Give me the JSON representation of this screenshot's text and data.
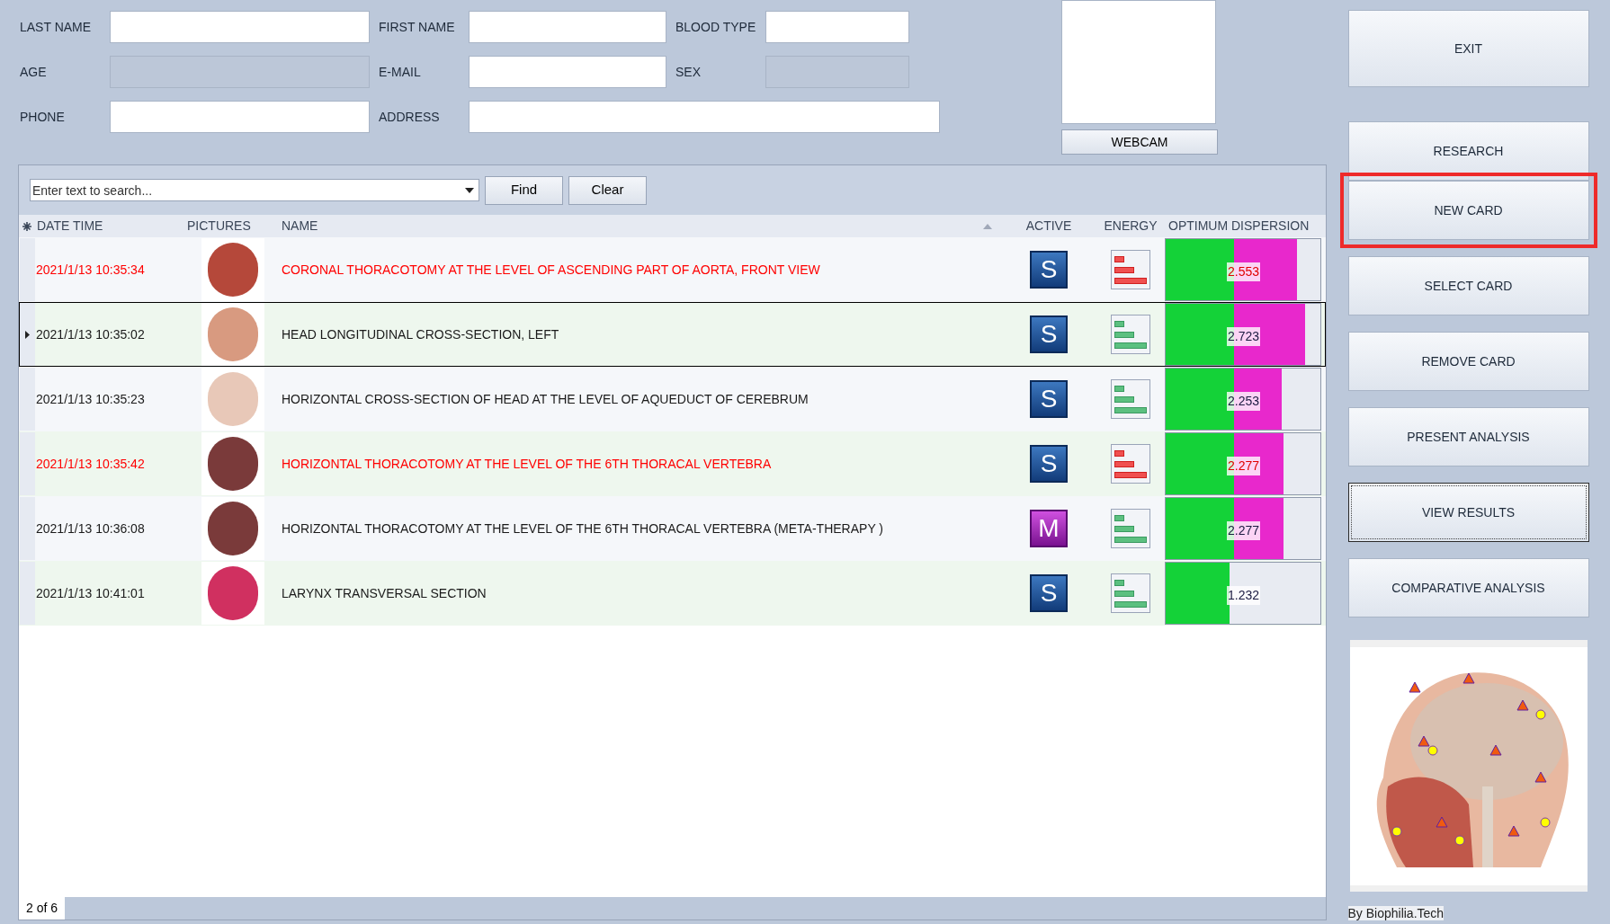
{
  "patient_form": {
    "fields": [
      {
        "label": "LAST NAME",
        "disabled": false
      },
      {
        "label": "FIRST NAME",
        "disabled": false
      },
      {
        "label": "BLOOD TYPE",
        "disabled": false
      },
      {
        "label": "AGE",
        "disabled": true
      },
      {
        "label": "E-MAIL",
        "disabled": false
      },
      {
        "label": "SEX",
        "disabled": true
      },
      {
        "label": "PHONE",
        "disabled": false
      },
      {
        "label": "ADDRESS",
        "disabled": false
      }
    ]
  },
  "webcam": {
    "button": "WEBCAM"
  },
  "search": {
    "placeholder": "Enter text to search...",
    "buttons": [
      "Find",
      "Clear"
    ]
  },
  "table": {
    "columns": [
      "DATE TIME",
      "PICTURES",
      "NAME",
      "ACTIVE",
      "ENERGY",
      "OPTIMUM DISPERSION"
    ],
    "rows": [
      {
        "date_time": "2021/1/13 10:35:34",
        "name": "CORONAL THORACOTOMY AT THE LEVEL OF ASCENDING PART OF AORTA, FRONT VIEW",
        "alert": true,
        "selected": false,
        "active": "S",
        "kind": "s",
        "dispersion": "2.553",
        "level": 0.85
      },
      {
        "date_time": "2021/1/13 10:35:02",
        "name": "HEAD LONGITUDINAL CROSS-SECTION, LEFT",
        "alert": false,
        "selected": true,
        "active": "S",
        "kind": "s",
        "dispersion": "2.723",
        "level": 0.9
      },
      {
        "date_time": "2021/1/13 10:35:23",
        "name": "HORIZONTAL CROSS-SECTION OF HEAD AT THE LEVEL OF AQUEDUCT OF CEREBRUM",
        "alert": false,
        "selected": false,
        "active": "S",
        "kind": "s",
        "dispersion": "2.253",
        "level": 0.75
      },
      {
        "date_time": "2021/1/13 10:35:42",
        "name": "HORIZONTAL THORACOTOMY AT THE LEVEL OF THE 6TH THORACAL VERTEBRA",
        "alert": true,
        "selected": false,
        "active": "S",
        "kind": "s",
        "dispersion": "2.277",
        "level": 0.76
      },
      {
        "date_time": "2021/1/13 10:36:08",
        "name": "HORIZONTAL THORACOTOMY AT THE LEVEL OF THE 6TH THORACAL VERTEBRA (META-THERAPY )",
        "alert": false,
        "selected": false,
        "active": "M",
        "kind": "m",
        "dispersion": "2.277",
        "level": 0.76
      },
      {
        "date_time": "2021/1/13 10:41:01",
        "name": "LARYNX TRANSVERSAL SECTION",
        "alert": false,
        "selected": false,
        "active": "S",
        "kind": "s",
        "dispersion": "1.232",
        "level": 0.41
      }
    ]
  },
  "status_bar": {
    "position": "2 of 6"
  },
  "sidebar": {
    "buttons": [
      {
        "label": "EXIT",
        "highlighted": false,
        "focused": false
      },
      {
        "label": "RESEARCH",
        "highlighted": false,
        "focused": false
      },
      {
        "label": "NEW CARD",
        "highlighted": true,
        "focused": false
      },
      {
        "label": "SELECT CARD",
        "highlighted": false,
        "focused": false
      },
      {
        "label": "REMOVE CARD",
        "highlighted": false,
        "focused": false
      },
      {
        "label": "PRESENT ANALYSIS",
        "highlighted": false,
        "focused": false
      },
      {
        "label": "VIEW RESULTS",
        "highlighted": false,
        "focused": true
      },
      {
        "label": "COMPARATIVE ANALYSIS",
        "highlighted": false,
        "focused": false
      }
    ],
    "credit": "By Biophilia.Tech"
  }
}
